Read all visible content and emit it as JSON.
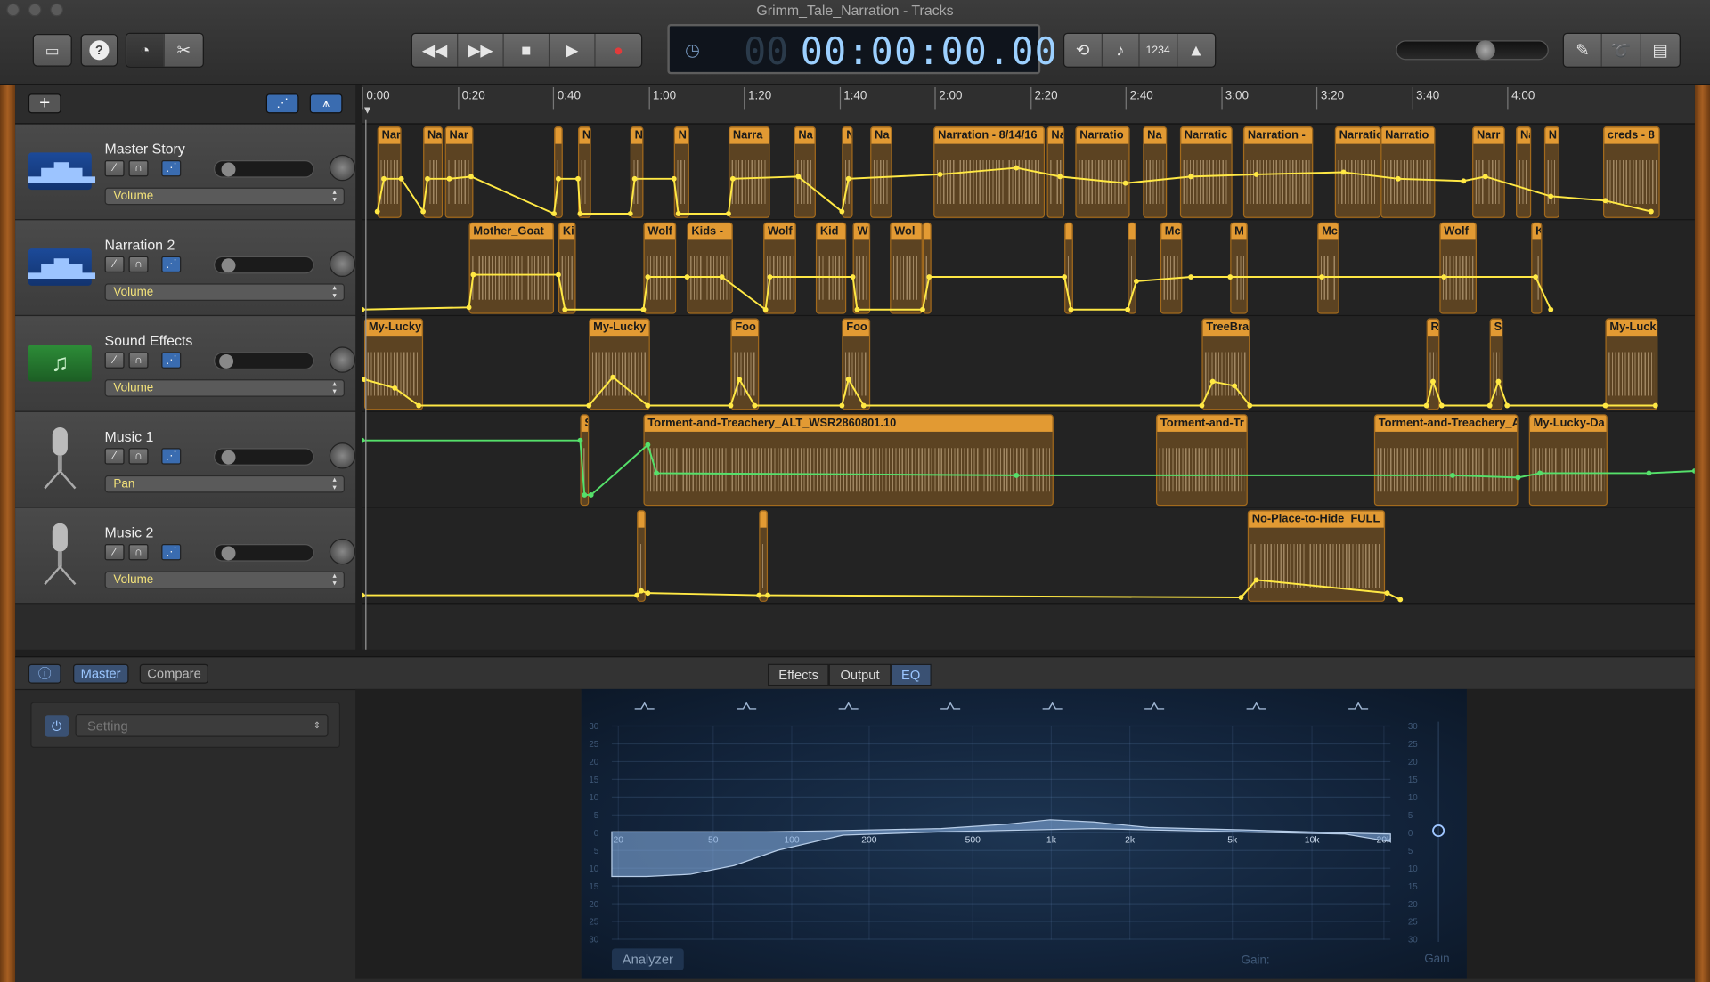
{
  "window": {
    "title": "Grimm_Tale_Narration - Tracks"
  },
  "toolbar": {
    "library_icon": "library-icon",
    "help_icon": "help-icon",
    "smart_controls_icon": "smart-controls-icon",
    "editors_icon": "scissors-icon",
    "transport": [
      "rewind-icon",
      "fast-forward-icon",
      "stop-icon",
      "play-icon",
      "record-icon"
    ],
    "lcd_time": "00:00:00.00",
    "lcd_ghost": "00",
    "cycle_icon": "cycle-icon",
    "tuner_icon": "tuner-icon",
    "count_in": "1234",
    "metronome_icon": "metronome-icon",
    "right_icons": [
      "notepad-icon",
      "loops-icon",
      "media-browser-icon"
    ]
  },
  "track_header": {
    "add_label": "+"
  },
  "ruler": {
    "ticks": [
      "0:00",
      "0:20",
      "0:40",
      "1:00",
      "1:20",
      "1:40",
      "2:00",
      "2:20",
      "2:40",
      "3:00",
      "3:20",
      "3:40",
      "4:00"
    ]
  },
  "tracks": [
    {
      "name": "Master Story",
      "automation": "Volume",
      "icon": "waveform-icon"
    },
    {
      "name": "Narration 2",
      "automation": "Volume",
      "icon": "waveform-icon"
    },
    {
      "name": "Sound Effects",
      "automation": "Volume",
      "icon": "music-note-icon"
    },
    {
      "name": "Music 1",
      "automation": "Pan",
      "icon": "microphone-icon"
    },
    {
      "name": "Music 2",
      "automation": "Volume",
      "icon": "microphone-icon"
    }
  ],
  "regions": {
    "master": [
      "Nar",
      "Na",
      "Nar",
      "",
      "N",
      "N",
      "N",
      "Narra",
      "Na",
      "N",
      "Na",
      "Narration - 8/14/16",
      "Na",
      "Narratio",
      "Na",
      "Narratic",
      "Narration -",
      "Narratic",
      "Narratio",
      "Narr",
      "Na",
      "N",
      "creds - 8"
    ],
    "narration2": [
      "Mother_Goat",
      "Ki",
      "Wolf",
      "Kids -",
      "Wolf",
      "Kid",
      "W",
      "Wol",
      "",
      "",
      "",
      "Mc",
      "M",
      "Mc",
      "Wolf",
      "K"
    ],
    "sfx": [
      "My-Lucky",
      "My-Lucky",
      "Foo",
      "Foo",
      "TreeBra",
      "R",
      "Sp",
      "My-Luck"
    ],
    "music1": [
      "S",
      "Torment-and-Treachery_ALT_WSR2860801.10",
      "Torment-and-Tr",
      "Torment-and-Treachery_A",
      "My-Lucky-Da"
    ],
    "music2": [
      "",
      "",
      "No-Place-to-Hide_FULL"
    ]
  },
  "smart_controls": {
    "info_icon": "info-icon",
    "master_label": "Master",
    "compare_label": "Compare",
    "tabs": [
      "Effects",
      "Output",
      "EQ"
    ],
    "active_tab": "EQ",
    "setting_placeholder": "Setting",
    "eq": {
      "freq_labels": [
        "20",
        "50",
        "100",
        "200",
        "500",
        "1k",
        "2k",
        "5k",
        "10k",
        "20k"
      ],
      "db_labels": [
        "30",
        "25",
        "20",
        "15",
        "10",
        "5",
        "0",
        "5",
        "10",
        "15",
        "20",
        "25",
        "30"
      ],
      "analyzer_label": "Analyzer",
      "gain_label": "Gain:",
      "gain_label2": "Gain"
    }
  },
  "colors": {
    "region": "#e29a33",
    "automation_yellow": "#ffe844",
    "automation_green": "#55e06a",
    "lcd": "#9cd0ff"
  }
}
